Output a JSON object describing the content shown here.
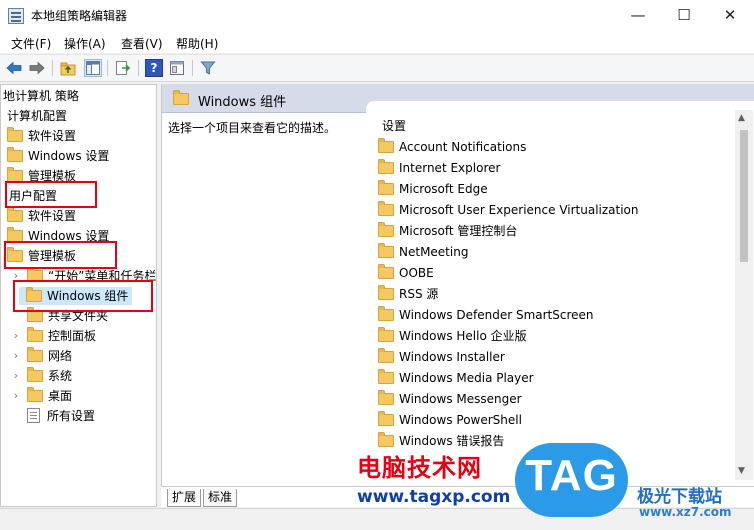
{
  "window": {
    "title": "本地组策略编辑器",
    "controls": {
      "minimize": "—",
      "maximize": "☐",
      "close": "✕"
    }
  },
  "menu": [
    "文件(F)",
    "操作(A)",
    "查看(V)",
    "帮助(H)"
  ],
  "toolbar": {
    "icons": [
      "back-arrow-icon",
      "forward-arrow-icon",
      "up-folder-icon",
      "show-hide-tree-icon",
      "export-list-icon",
      "help-icon",
      "view-icon",
      "filter-icon"
    ],
    "help_glyph": "?"
  },
  "tree": {
    "root": "地计算机 策略",
    "computer_config": "计算机配置",
    "software_settings_1": "软件设置",
    "windows_settings_1": "Windows 设置",
    "admin_templates_1": "管理模板",
    "user_config": "用户配置",
    "software_settings_2": "软件设置",
    "windows_settings_2": "Windows 设置",
    "admin_templates_2": "管理模板",
    "start_menu": "“开始”菜单和任务栏",
    "windows_components": "Windows 组件",
    "shared_folders": "共享文件夹",
    "control_panel": "控制面板",
    "network": "网络",
    "system": "系统",
    "desktop": "桌面",
    "all_settings": "所有设置",
    "chevron": "›"
  },
  "content": {
    "header_title": "Windows 组件",
    "description": "选择一个项目来查看它的描述。",
    "list_header": "设置",
    "items": [
      "Account Notifications",
      "Internet Explorer",
      "Microsoft Edge",
      "Microsoft User Experience Virtualization",
      "Microsoft 管理控制台",
      "NetMeeting",
      "OOBE",
      "RSS 源",
      "Windows Defender SmartScreen",
      "Windows Hello 企业版",
      "Windows Installer",
      "Windows Media Player",
      "Windows Messenger",
      "Windows PowerShell",
      "Windows 错误报告"
    ]
  },
  "scrollbar": {
    "up": "▲",
    "down": "▼",
    "thumb_fraction": 0.36
  },
  "tabs": {
    "expand": "扩展",
    "standard": "标准"
  },
  "watermarks": {
    "site_name": "电脑技术网",
    "site_url": "www.tagxp.com",
    "logo_text": "TAG",
    "brand": "极光下载站",
    "brand_url": "www.xz7.com"
  },
  "colors": {
    "annotation_red": "#e60012",
    "selected_row": "#cce8ff",
    "header_band": "#d6dbe9",
    "folder": "#f5c95f"
  }
}
